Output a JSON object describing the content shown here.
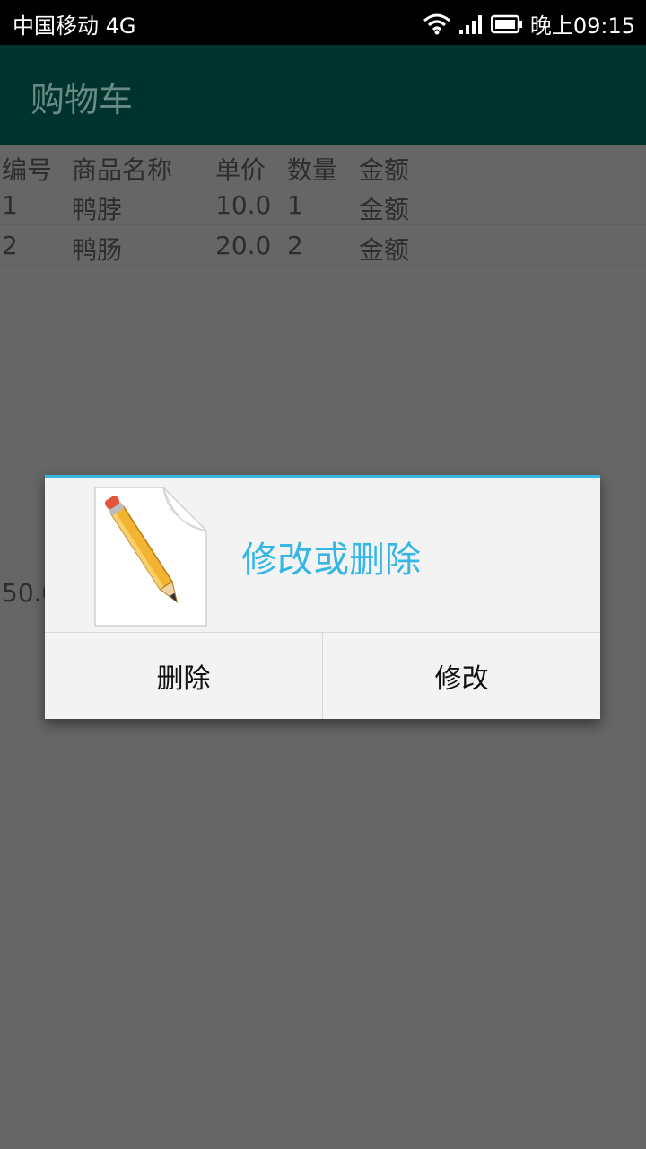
{
  "status_bar": {
    "carrier": "中国移动 4G",
    "time": "晚上09:15",
    "icons": [
      "wifi-icon",
      "signal-icon",
      "battery-icon"
    ]
  },
  "app_bar": {
    "title": "购物车"
  },
  "table": {
    "headers": [
      "编号",
      "商品名称",
      "单价",
      "数量",
      "金额"
    ],
    "rows": [
      [
        "1",
        "鸭脖",
        "10.0",
        "1",
        "金额"
      ],
      [
        "2",
        "鸭肠",
        "20.0",
        "2",
        "金额"
      ]
    ]
  },
  "total_partial": "50.0",
  "dialog": {
    "title": "修改或删除",
    "icon": "pencil-document-icon",
    "buttons": {
      "delete": "删除",
      "edit": "修改"
    }
  },
  "colors": {
    "status_bar": "#000000",
    "app_bar": "#01332e",
    "scrim_background": "#666666",
    "dialog_accent": "#35b6e5",
    "dialog_background": "#f3f3f3"
  }
}
